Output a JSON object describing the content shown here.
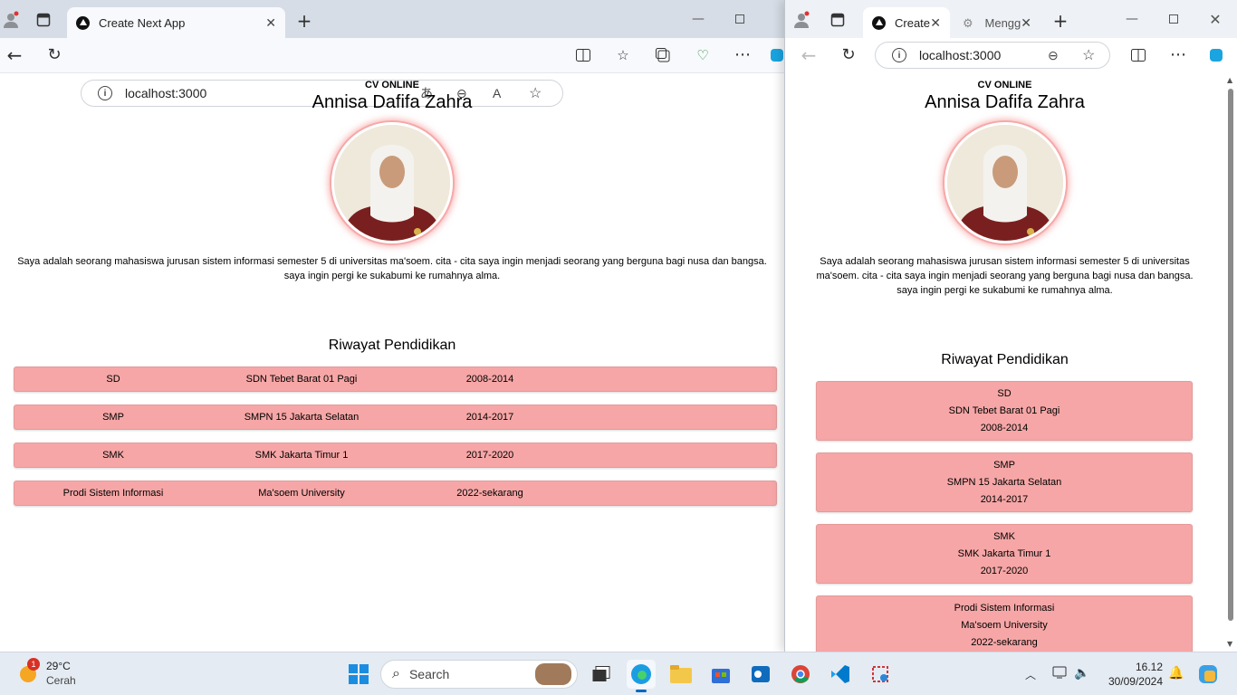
{
  "left_browser": {
    "tab_title": "Create Next App",
    "url": "localhost:3000"
  },
  "right_browser": {
    "tab1_title": "Create",
    "tab2_title": "Mengg",
    "url": "localhost:3000"
  },
  "cv": {
    "header": "CV ONLINE",
    "name": "Annisa Dafifa Zahra",
    "description": "Saya adalah seorang mahasiswa jurusan sistem informasi semester 5 di universitas ma'soem. cita - cita saya ingin menjadi seorang yang berguna bagi nusa dan bangsa. saya ingin pergi ke sukabumi ke rumahnya alma.",
    "education_title": "Riwayat Pendidikan",
    "education": [
      {
        "level": "SD",
        "school": "SDN Tebet Barat 01 Pagi",
        "years": "2008-2014"
      },
      {
        "level": "SMP",
        "school": "SMPN 15 Jakarta Selatan",
        "years": "2014-2017"
      },
      {
        "level": "SMK",
        "school": "SMK Jakarta Timur 1",
        "years": "2017-2020"
      },
      {
        "level": "Prodi Sistem Informasi",
        "school": "Ma'soem University",
        "years": "2022-sekarang"
      }
    ]
  },
  "taskbar": {
    "weather_temp": "29°C",
    "weather_text": "Cerah",
    "weather_badge": "1",
    "search_label": "Search",
    "time": "16.12",
    "date": "30/09/2024"
  },
  "colors": {
    "row_bg": "#f6a6a6",
    "photo_glow": "#f6a8a8"
  }
}
